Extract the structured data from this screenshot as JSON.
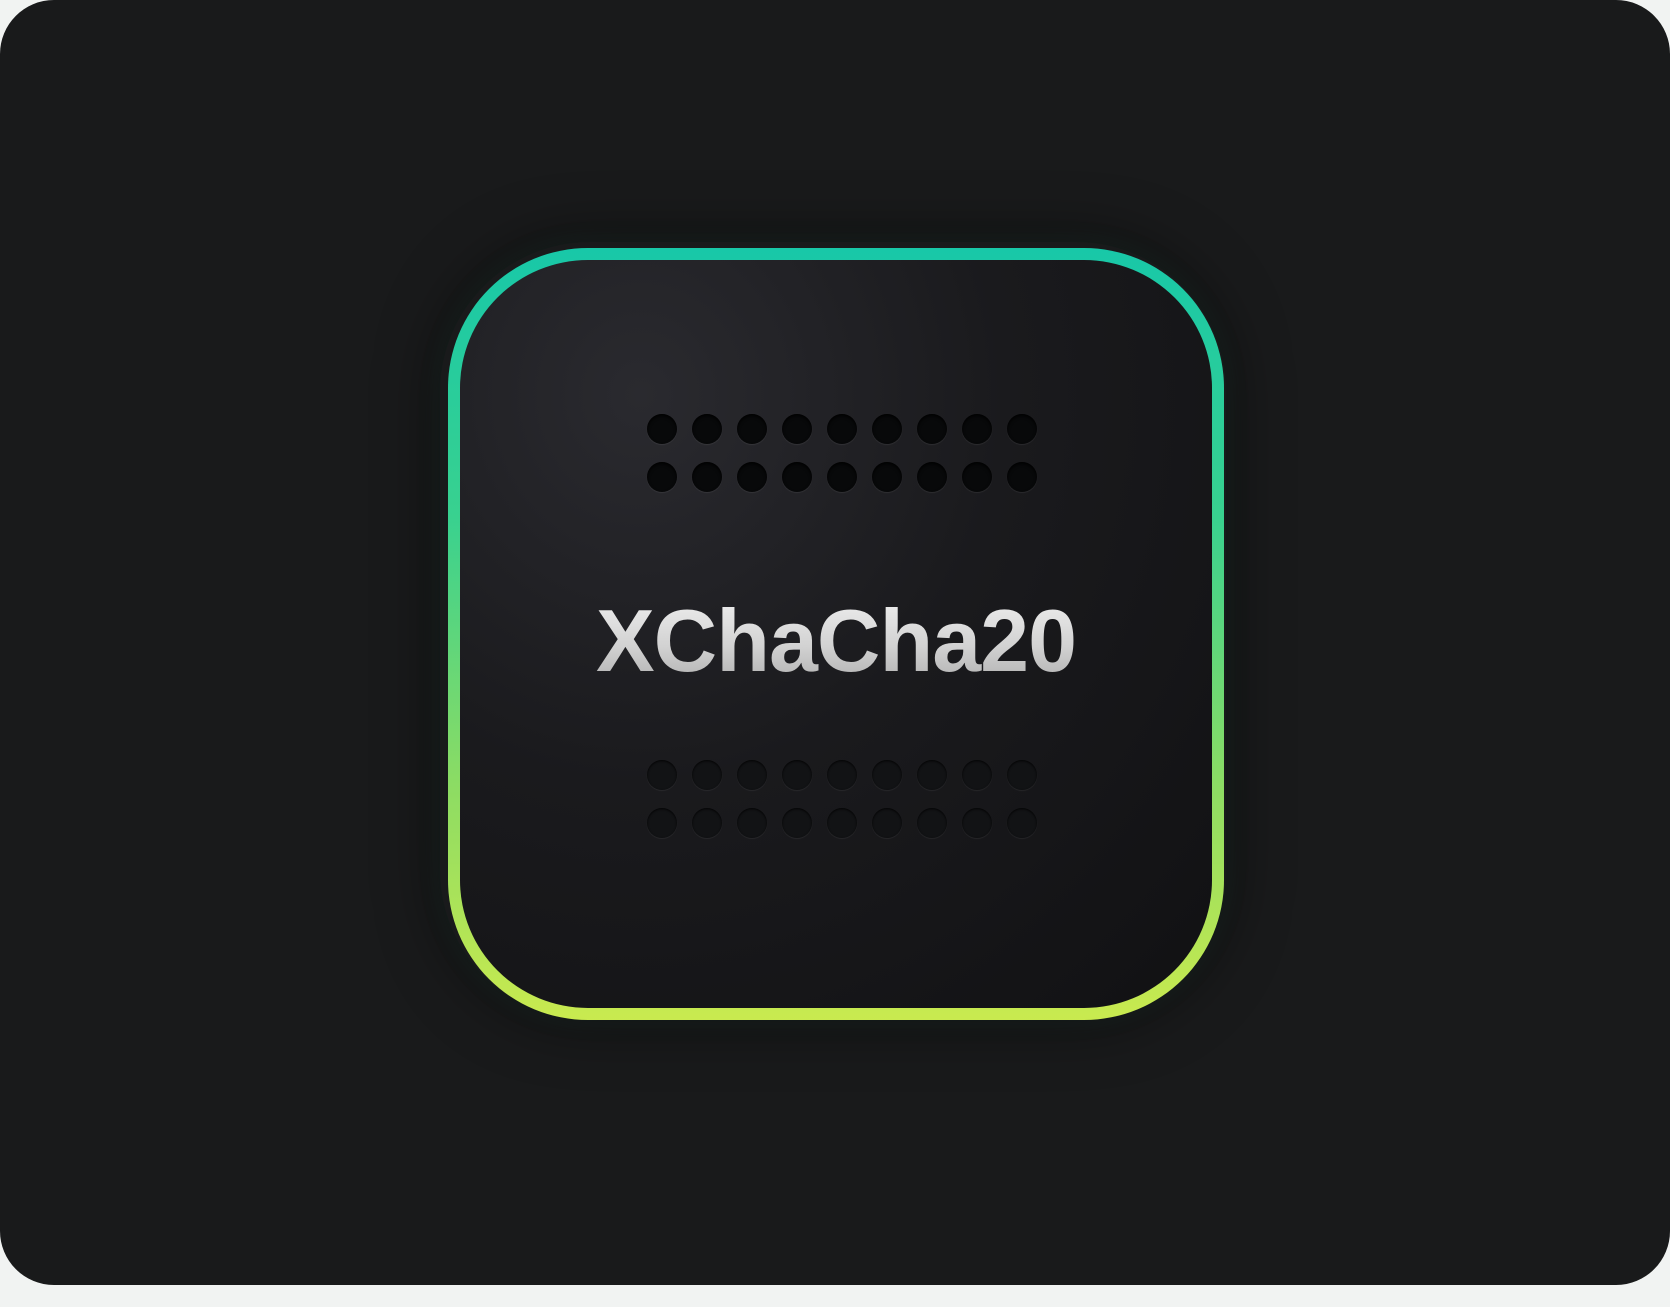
{
  "chip": {
    "label": "XChaCha20",
    "border_gradient": [
      "#18c8a8",
      "#39d18f",
      "#8ddc63",
      "#c9ea4f"
    ],
    "face_color": "#111113"
  },
  "background": {
    "card_color": "#191a1b",
    "page_color": "#f1f3f2"
  },
  "dot_grids": {
    "top": {
      "rows": 2,
      "cols": 9,
      "style": "filled"
    },
    "bottom": {
      "rows": 2,
      "cols": 9,
      "style": "ring"
    }
  }
}
